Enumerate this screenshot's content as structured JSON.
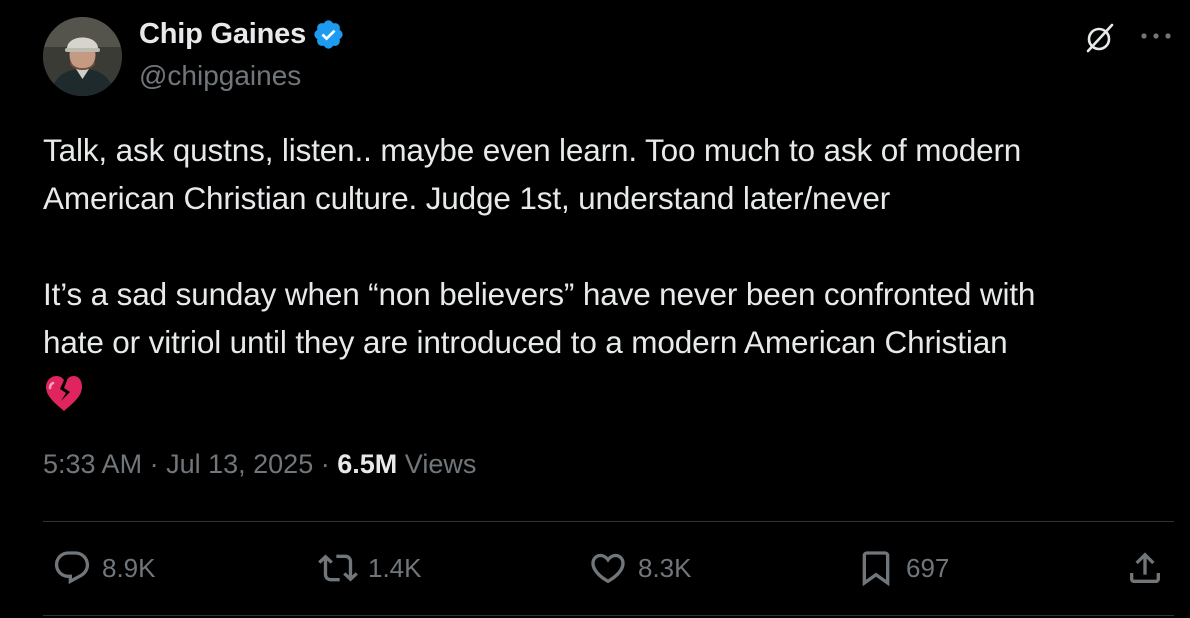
{
  "author": {
    "display_name": "Chip Gaines",
    "handle": "@chipgaines",
    "verified": true,
    "verified_color": "#1d9bf0"
  },
  "tweet": {
    "lines_p1": [
      "Talk, ask qustns, listen.. maybe even learn. Too much to ask of modern",
      "American Christian culture. Judge 1st, understand later/never"
    ],
    "lines_p2": [
      "It’s a sad sunday when “non believers” have never been confronted with",
      "hate or vitriol until they are introduced to a modern American Christian"
    ],
    "trailing_emoji": "broken-heart-emoji"
  },
  "meta": {
    "time": "5:33 AM",
    "separator": "·",
    "date": "Jul 13, 2025",
    "views_count": "6.5M",
    "views_label": "Views"
  },
  "actions": {
    "reply": {
      "icon": "reply-icon",
      "count": "8.9K"
    },
    "repost": {
      "icon": "repost-icon",
      "count": "1.4K"
    },
    "like": {
      "icon": "heart-icon",
      "count": "8.3K"
    },
    "bookmark": {
      "icon": "bookmark-icon",
      "count": "697"
    },
    "share": {
      "icon": "share-icon"
    }
  },
  "header_icons": [
    "grok-icon",
    "more-options-icon"
  ],
  "colors": {
    "background": "#000000",
    "text_primary": "#e7e9ea",
    "text_secondary": "#71767b",
    "divider": "#2f3336",
    "emoji_red": "#e0245e"
  }
}
